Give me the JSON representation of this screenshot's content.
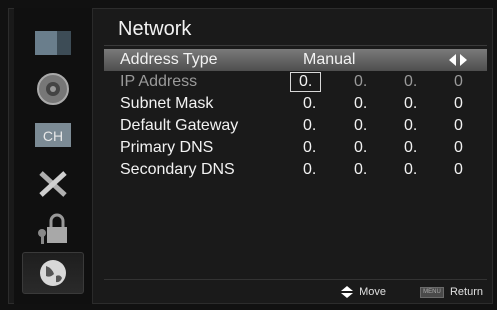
{
  "title": "Network",
  "rows": [
    {
      "label": "Address Type",
      "value": "Manual",
      "selected": true
    },
    {
      "label": "IP Address",
      "octets": [
        "0.",
        "0.",
        "0.",
        "0"
      ]
    },
    {
      "label": "Subnet Mask",
      "octets": [
        "0.",
        "0.",
        "0.",
        "0"
      ]
    },
    {
      "label": "Default Gateway",
      "octets": [
        "0.",
        "0.",
        "0.",
        "0"
      ]
    },
    {
      "label": "Primary DNS",
      "octets": [
        "0.",
        "0.",
        "0.",
        "0"
      ]
    },
    {
      "label": "Secondary DNS",
      "octets": [
        "0.",
        "0.",
        "0.",
        "0"
      ]
    }
  ],
  "footer": {
    "move": "Move",
    "menu_key": "MENU",
    "return": "Return"
  },
  "sidebar": [
    {
      "name": "picture-icon"
    },
    {
      "name": "sound-icon"
    },
    {
      "name": "channel-icon",
      "text": "CH"
    },
    {
      "name": "tools-icon"
    },
    {
      "name": "lock-icon"
    },
    {
      "name": "globe-icon",
      "active": true
    }
  ]
}
